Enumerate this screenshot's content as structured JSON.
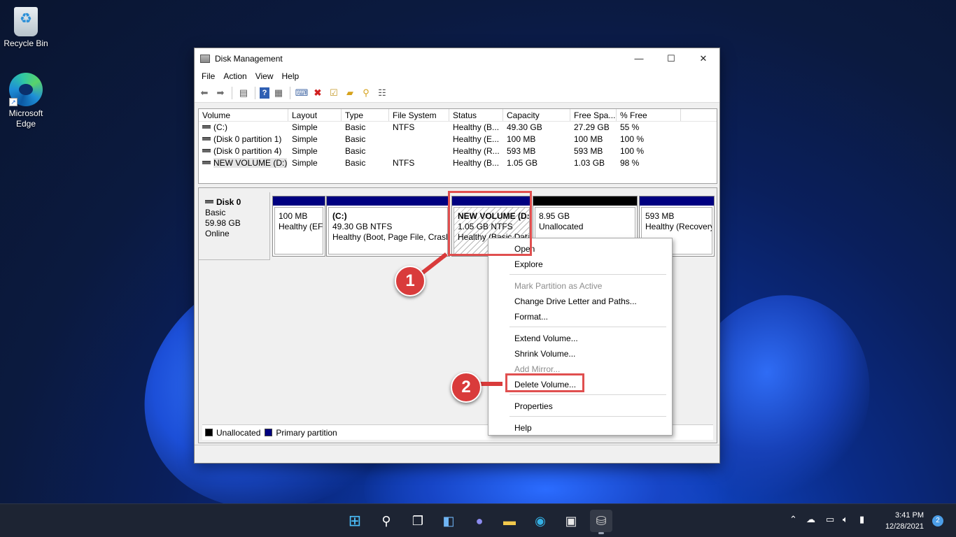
{
  "desktop": {
    "icons": [
      {
        "label": "Recycle Bin"
      },
      {
        "label": "Microsoft Edge"
      }
    ]
  },
  "window": {
    "title": "Disk Management",
    "controls": {
      "minimize": "—",
      "maximize": "☐",
      "close": "✕"
    },
    "menu": [
      "File",
      "Action",
      "View",
      "Help"
    ],
    "toolbar_icons": [
      "back-icon",
      "forward-icon",
      "properties-icon",
      "help-icon",
      "console-icon",
      "connect-icon",
      "delete-icon",
      "check-icon",
      "open-folder-icon",
      "explore-icon",
      "list-icon"
    ]
  },
  "volume_table": {
    "headers": [
      "Volume",
      "Layout",
      "Type",
      "File System",
      "Status",
      "Capacity",
      "Free Spa...",
      "% Free"
    ],
    "rows": [
      [
        "(C:)",
        "Simple",
        "Basic",
        "NTFS",
        "Healthy (B...",
        "49.30 GB",
        "27.29 GB",
        "55 %"
      ],
      [
        "(Disk 0 partition 1)",
        "Simple",
        "Basic",
        "",
        "Healthy (E...",
        "100 MB",
        "100 MB",
        "100 %"
      ],
      [
        "(Disk 0 partition 4)",
        "Simple",
        "Basic",
        "",
        "Healthy (R...",
        "593 MB",
        "593 MB",
        "100 %"
      ],
      [
        "NEW VOLUME (D:)",
        "Simple",
        "Basic",
        "NTFS",
        "Healthy (B...",
        "1.05 GB",
        "1.03 GB",
        "98 %"
      ]
    ]
  },
  "disk": {
    "name": "Disk 0",
    "type": "Basic",
    "size": "59.98 GB",
    "status": "Online",
    "partitions": [
      {
        "line1": "",
        "line2": "100 MB",
        "line3": "Healthy (EF"
      },
      {
        "line1": "(C:)",
        "line2": "49.30 GB NTFS",
        "line3": "Healthy (Boot, Page File, Crash"
      },
      {
        "line1": "NEW VOLUME  (D:",
        "line2": "1.05 GB NTFS",
        "line3": "Healthy (Basic Data"
      },
      {
        "line1": "",
        "line2": "8.95 GB",
        "line3": "Unallocated"
      },
      {
        "line1": "",
        "line2": "593 MB",
        "line3": "Healthy (Recovery"
      }
    ]
  },
  "legend": {
    "unallocated": "Unallocated",
    "primary": "Primary partition"
  },
  "context_menu": {
    "items": [
      {
        "label": "Open",
        "enabled": true
      },
      {
        "label": "Explore",
        "enabled": true
      },
      {
        "label": "Mark Partition as Active",
        "enabled": false
      },
      {
        "label": "Change Drive Letter and Paths...",
        "enabled": true
      },
      {
        "label": "Format...",
        "enabled": true
      },
      {
        "label": "Extend Volume...",
        "enabled": true
      },
      {
        "label": "Shrink Volume...",
        "enabled": true
      },
      {
        "label": "Add Mirror...",
        "enabled": false
      },
      {
        "label": "Delete Volume...",
        "enabled": true
      },
      {
        "label": "Properties",
        "enabled": true
      },
      {
        "label": "Help",
        "enabled": true
      }
    ]
  },
  "annotations": {
    "step1": "1",
    "step2": "2",
    "color": "#d93b3b"
  },
  "taskbar": {
    "apps": [
      "start-icon",
      "search-icon",
      "task-view-icon",
      "widgets-icon",
      "chat-icon",
      "file-explorer-icon",
      "edge-icon",
      "store-icon",
      "disk-management-icon"
    ],
    "time": "3:41 PM",
    "date": "12/28/2021",
    "notification_count": "2"
  },
  "colors": {
    "primary_partition": "#000080",
    "unallocated": "#000000",
    "highlight": "#e04f4f"
  }
}
